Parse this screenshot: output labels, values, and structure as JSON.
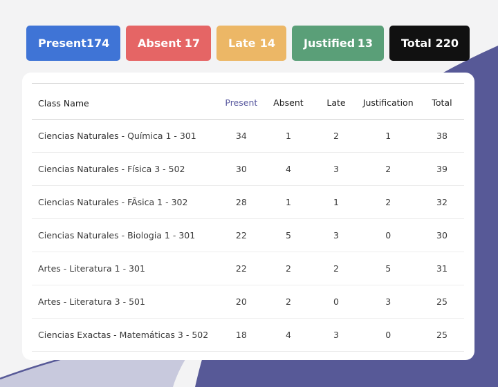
{
  "colors": {
    "background": "#f3f3f4",
    "present": "#3f74d6",
    "absent": "#e56565",
    "late": "#ecb766",
    "justified": "#5a9f78",
    "total": "#111111",
    "present_header": "#5a5aa0",
    "decor_dark": "#575997",
    "decor_light": "#c8c9dd"
  },
  "summary": [
    {
      "label": "Present",
      "value": "174",
      "color": "#3f74d6"
    },
    {
      "label": "Absent",
      "value": "17",
      "color": "#e56565"
    },
    {
      "label": "Late",
      "value": "14",
      "color": "#ecb766"
    },
    {
      "label": "Justified",
      "value": "13",
      "color": "#5a9f78"
    },
    {
      "label": "Total",
      "value": "220",
      "color": "#111111"
    }
  ],
  "table": {
    "headers": [
      "Class Name",
      "Present",
      "Absent",
      "Late",
      "Justification",
      "Total"
    ],
    "rows": [
      [
        "Ciencias Naturales - Química 1 - 301",
        "34",
        "1",
        "2",
        "1",
        "38"
      ],
      [
        "Ciencias Naturales - Física 3 - 502",
        "30",
        "4",
        "3",
        "2",
        "39"
      ],
      [
        "Ciencias Naturales - FÃsica 1 - 302",
        "28",
        "1",
        "1",
        "2",
        "32"
      ],
      [
        "Ciencias Naturales - Biologia 1 - 301",
        "22",
        "5",
        "3",
        "0",
        "30"
      ],
      [
        "Artes - Literatura 1 - 301",
        "22",
        "2",
        "2",
        "5",
        "31"
      ],
      [
        "Artes - Literatura 3 - 501",
        "20",
        "2",
        "0",
        "3",
        "25"
      ],
      [
        "Ciencias Exactas - Matemáticas 3 - 502",
        "18",
        "4",
        "3",
        "0",
        "25"
      ]
    ]
  }
}
